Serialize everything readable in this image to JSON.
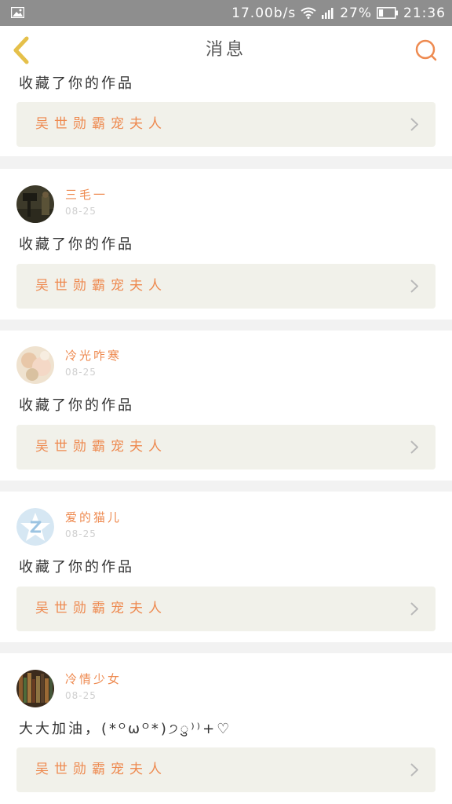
{
  "status_bar": {
    "net_speed": "17.00b/s",
    "battery_pct": "27%",
    "time": "21:36"
  },
  "nav": {
    "title": "消息",
    "back_icon": "chevron-left-icon",
    "search_icon": "search-icon"
  },
  "colors": {
    "accent": "#ee8a50",
    "back_icon": "#e5c04a",
    "card_link_bg": "#f1f1ea",
    "feed_bg": "#f2f2f2",
    "status_bar_bg": "#8e8e8e"
  },
  "notifications": [
    {
      "message": "收藏了你的作品",
      "work_title": "吴世勋霸宠夫人"
    },
    {
      "user": "三毛一",
      "date": "08-25",
      "message": "收藏了你的作品",
      "work_title": "吴世勋霸宠夫人"
    },
    {
      "user": "冷光咋寒",
      "date": "08-25",
      "message": "收藏了你的作品",
      "work_title": "吴世勋霸宠夫人"
    },
    {
      "user": "爱的猫儿",
      "date": "08-25",
      "message": "收藏了你的作品",
      "work_title": "吴世勋霸宠夫人"
    },
    {
      "user": "冷情少女",
      "date": "08-25",
      "message": "大大加油，(*ᴼωᴼ*)੭ु⁾⁾+♡",
      "work_title": "吴世勋霸宠夫人"
    }
  ]
}
